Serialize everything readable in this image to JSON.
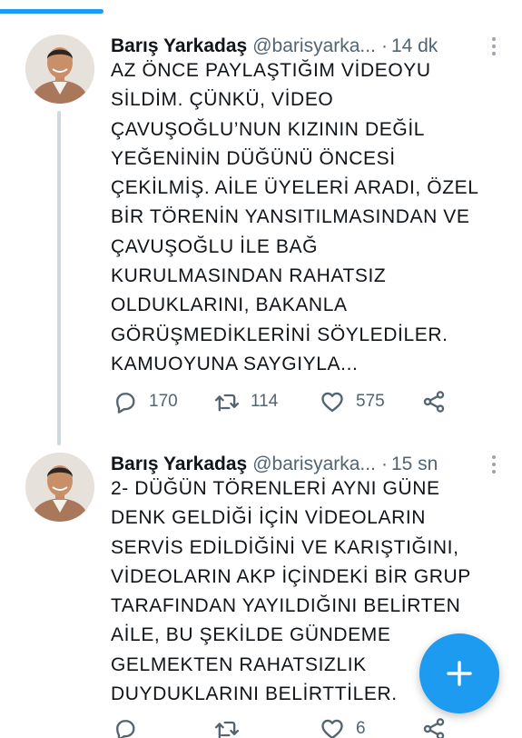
{
  "colors": {
    "accent": "#1d9bf0",
    "text": "#0f1419",
    "muted": "#536471",
    "thread_line": "#cfd9de"
  },
  "tweets": [
    {
      "name": "Barış Yarkadaş",
      "handle": "@barisyarka...",
      "dot": "·",
      "time": "14 dk",
      "text": "AZ ÖNCE PAYLAŞTIĞIM VİDEOYU\nSİLDİM. ÇÜNKÜ, VİDEO\nÇAVUŞOĞLU’NUN KIZININ DEĞİL\nYEĞENİNİN DÜĞÜNÜ ÖNCESİ\nÇEKİLMİŞ. AİLE ÜYELERİ ARADI, ÖZEL\nBİR TÖRENİN YANSITILMASINDAN VE\nÇAVUŞOĞLU İLE BAĞ\nKURULMASINDAN RAHATSIZ\nOLDUKLARINI, BAKANLA\nGÖRÜŞMEDİKLERİNİ SÖYLEDİLER.\nKAMUOYUNA SAYGIYLA...",
      "replies": "170",
      "retweets": "114",
      "likes": "575",
      "icons": [
        "more-icon",
        "reply-icon",
        "retweet-icon",
        "like-icon",
        "share-icon"
      ]
    },
    {
      "name": "Barış Yarkadaş",
      "handle": "@barisyarka...",
      "dot": "·",
      "time": "15 sn",
      "text": "2- DÜĞÜN TÖRENLERİ AYNI GÜNE\nDENK GELDİĞİ İÇİN VİDEOLARIN\nSERVİS EDİLDİĞİNİ VE KARIŞTIĞINI,\nVİDEOLARIN AKP İÇİNDEKİ BİR GRUP\nTARAFINDAN YAYILDIĞINI BELİRTEN\nAİLE, BU ŞEKİLDE GÜNDEME\nGELMEKTEN RAHATSIZLIK\nDUYDUKLARINI BELİRTTİLER.",
      "replies": "",
      "retweets": "",
      "likes": "6",
      "icons": [
        "more-icon",
        "reply-icon",
        "retweet-icon",
        "like-icon",
        "share-icon"
      ]
    }
  ],
  "fab": {
    "icon": "plus-icon",
    "label": "compose"
  }
}
